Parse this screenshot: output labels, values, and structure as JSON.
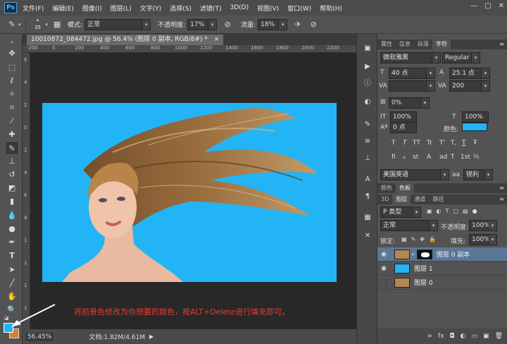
{
  "app": {
    "logo": "Ps"
  },
  "menu": [
    "文件(F)",
    "编辑(E)",
    "图像(I)",
    "图层(L)",
    "文字(Y)",
    "选择(S)",
    "滤镜(T)",
    "3D(D)",
    "视图(V)",
    "窗口(W)",
    "帮助(H)"
  ],
  "window_controls": [
    "—",
    "□",
    "✕"
  ],
  "options": {
    "brush_size": "35",
    "mode_label": "模式:",
    "mode_value": "正常",
    "opacity_label": "不透明度:",
    "opacity_value": "17%",
    "flow_label": "流量:",
    "flow_value": "18%"
  },
  "document": {
    "tab_title": "10010872_084472.jpg @ 56.4% (图层 0 副本, RGB/8#) *",
    "tab_close": "×",
    "zoom": "56.45%",
    "doc_info": "文档:1.82M/4.61M"
  },
  "ruler": {
    "top": [
      "-200",
      "0",
      "200",
      "400",
      "600",
      "800",
      "1000",
      "1200",
      "1400",
      "1600",
      "1800",
      "2000",
      "2200"
    ],
    "left": [
      "6",
      "4",
      "2",
      "0",
      "2",
      "4",
      "6",
      "8",
      "1",
      "1",
      "1",
      "1"
    ]
  },
  "annotation": "将前景色修改为你想要的颜色，按ALT+Delete进行填充即可。",
  "character": {
    "tabs": [
      "属性",
      "信息",
      "段落",
      "字符"
    ],
    "font_family": "微软雅黑",
    "font_style": "Regular",
    "size": "40 点",
    "leading": "25.1 点",
    "kerning": "",
    "tracking": "200",
    "scale_label": "0%",
    "vscale": "100%",
    "hscale": "100%",
    "baseline": "0 点",
    "color_label": "颜色:",
    "style_glyphs": [
      "T",
      "T",
      "TT",
      "Tr",
      "T'",
      "T,",
      "T",
      "Ŧ"
    ],
    "extra_glyphs": [
      "fi",
      "ℴ",
      "st",
      "A",
      "ad",
      "T",
      "1st",
      "½"
    ],
    "language": "美国英语",
    "aa_label": "aa",
    "aa_value": "锐利"
  },
  "color_panel": {
    "tabs": [
      "颜色",
      "色板"
    ]
  },
  "layers": {
    "tabs": [
      "3D",
      "图层",
      "通道",
      "路径"
    ],
    "filter_label": "P 类型",
    "blend_mode": "正常",
    "opacity_label": "不透明度:",
    "opacity_value": "100%",
    "lock_label": "锁定:",
    "fill_label": "填充:",
    "fill_value": "100%",
    "items": [
      {
        "name": "图层 0 副本",
        "selected": true
      },
      {
        "name": "图层 1",
        "selected": false
      },
      {
        "name": "图层 0",
        "selected": false
      }
    ]
  },
  "colors": {
    "fill": "#23b4f5",
    "foreground": "#23b4f5",
    "background": "#e07b2b"
  }
}
